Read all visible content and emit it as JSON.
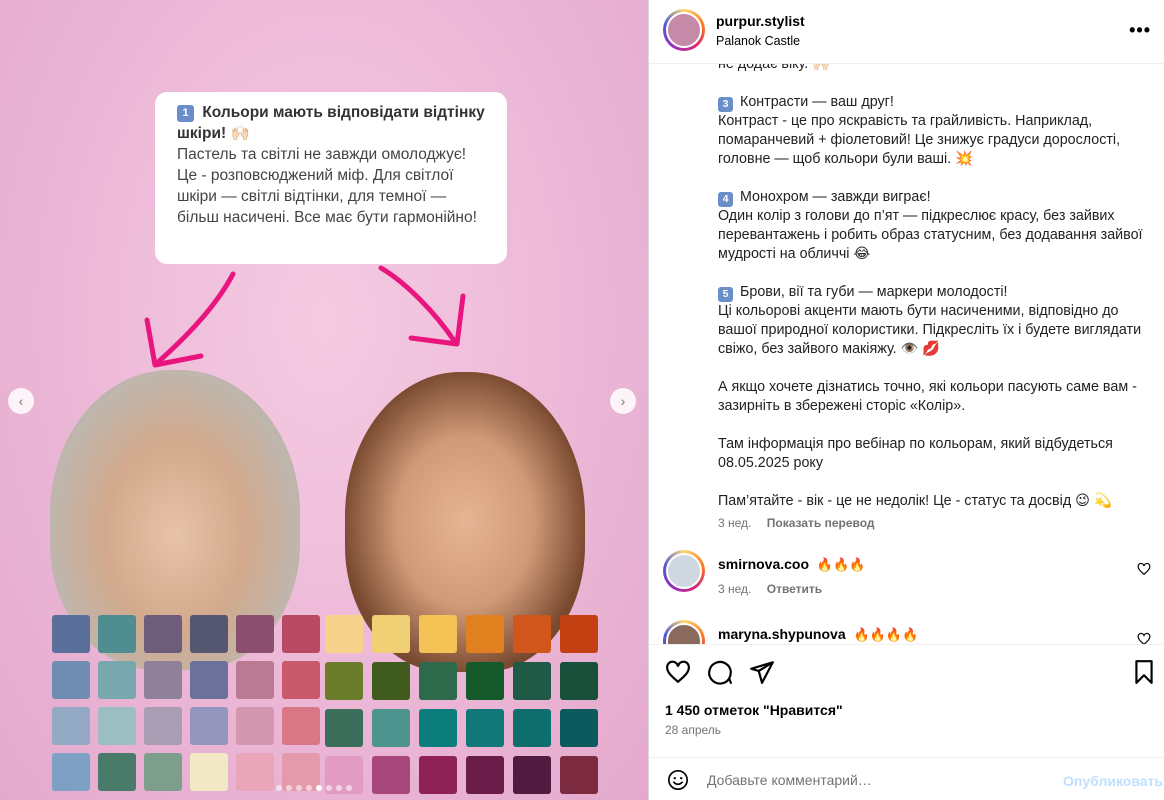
{
  "media": {
    "callout": {
      "number": "1",
      "title": "Кольори мають відповідати відтінку шкіри!",
      "title_emoji": "🙌🏻",
      "body": "Пастель та світлі не завжди омолоджує! Це - розповсюджений міф. Для світлої шкіри — світлі відтінки, для темної — більш насичені. Все має бути гармонійно!"
    },
    "prev_icon": "chevron-left-icon",
    "next_icon": "chevron-right-icon",
    "dots_count": 8,
    "active_dot": 4,
    "left_swatches": [
      "#5a6f9a",
      "#4f8d91",
      "#6e5c7b",
      "#55566f",
      "#8a4f6c",
      "#b84a63",
      "#6f8db0",
      "#78a8ad",
      "#8f8199",
      "#6c7199",
      "#b97a92",
      "#c85a6c",
      "#93a9c4",
      "#9bbec3",
      "#a89db3",
      "#9496bd",
      "#d398ad",
      "#d97787",
      "#7ea0c4",
      "#4a7a6a",
      "#7c9e8a",
      "#f1e9c3",
      "#e9a6b9",
      "#e59aab"
    ],
    "right_swatches": [
      "#f7d28a",
      "#efd074",
      "#f5c355",
      "#e0801f",
      "#d1561c",
      "#c34012",
      "#6b7d2a",
      "#3f5b1d",
      "#2c6a4b",
      "#165a2c",
      "#1f5a47",
      "#18503c",
      "#3c6f5b",
      "#4d948e",
      "#0b7e7b",
      "#127778",
      "#0e6d6d",
      "#0d5a5e",
      "#e29cc4",
      "#a7477c",
      "#8e2155",
      "#6b1d4a",
      "#501b40",
      "#7b2a3f"
    ]
  },
  "header": {
    "username": "purpur.stylist",
    "location": "Palanok Castle",
    "more_icon": "more-horizontal-icon"
  },
  "caption": {
    "cut_line": "не додає віку. 🙌🏻",
    "p3_num": "3",
    "p3_title": "Контрасти — ваш друг!",
    "p3_body": "Контраст - це про яскравість та грайливість. Наприклад, помаранчевий + фіолетовий! Це знижує градуси дорослості, головне — щоб кольори були ваші. 💥",
    "p4_num": "4",
    "p4_title": "Монохром — завжди виграє!",
    "p4_body": "Один колір з голови до п’ят — підкреслює красу, без зайвих перевантажень і робить образ статусним, без додавання зайвої мудрості на обличчі 😂",
    "p5_num": "5",
    "p5_title": "Брови, вії та губи — маркери молодості!",
    "p5_body": "Ці кольорові акценти мають бути насиченими, відповідно до вашої природної колористики. Підкресліть їх і будете виглядати свіжо, без зайвого макіяжу. 👁️ 💋",
    "p6": "А якщо хочете дізнатись точно, які кольори пасують саме вам - зазирніть в збережені сторіс «Колір».",
    "p7": "Там інформація про вебінар по кольорам, який відбудеться 08.05.2025 року",
    "p8": "Пам’ятайте - вік - це не недолік! Це - статус та досвід 😉 💫",
    "time": "3 нед.",
    "translate": "Показать перевод"
  },
  "comments": [
    {
      "username": "smirnova.coo",
      "text": "🔥🔥🔥",
      "time": "3 нед.",
      "reply": "Ответить"
    },
    {
      "username": "maryna.shypunova",
      "text": "🔥🔥🔥🔥",
      "time": "",
      "reply": ""
    }
  ],
  "actions": {
    "likes": "1 450 отметок \"Нравится\"",
    "date": "28 апрель"
  },
  "comment_bar": {
    "placeholder": "Добавьте комментарий…",
    "post_label": "Опубликовать"
  },
  "colors": {
    "accent_pink": "#e9157e",
    "post_disabled": "#c0dffd",
    "number_badge": "#6a8ec9"
  }
}
